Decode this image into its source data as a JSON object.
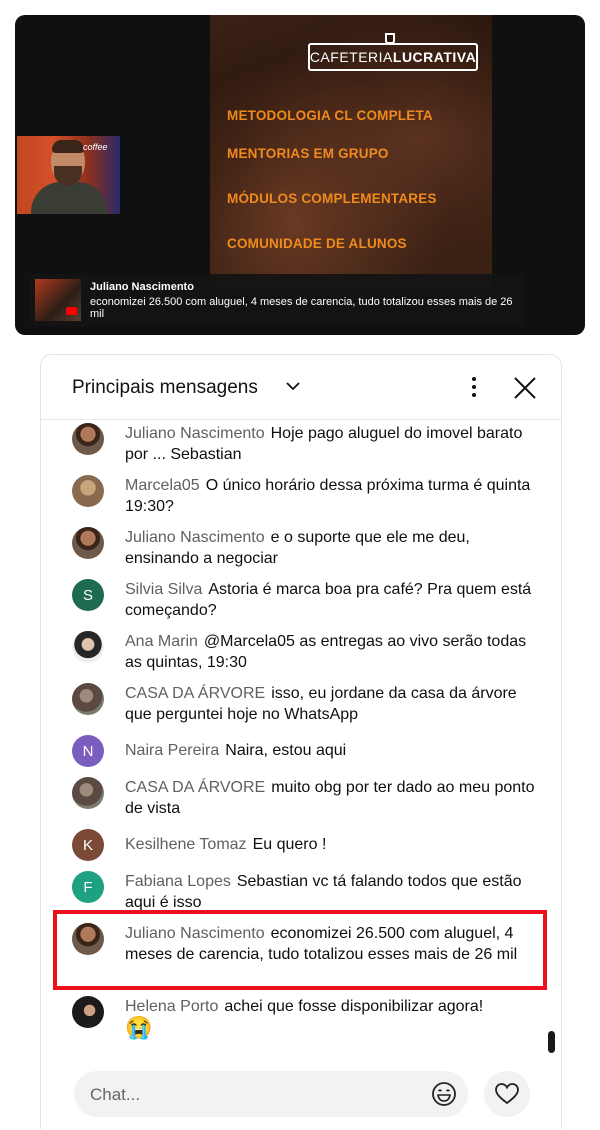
{
  "video": {
    "brand_left": "CAFETERIA",
    "brand_right": "LUCRATIVA",
    "menu": [
      "METODOLOGIA CL COMPLETA",
      "MENTORIAS EM GRUPO",
      "MÓDULOS COMPLEMENTARES",
      "COMUNIDADE DE ALUNOS"
    ],
    "webcam_sign": "coffee",
    "caption": {
      "author": "Juliano Nascimento",
      "message": "economizei 26.500 com aluguel, 4 meses de carencia, tudo totalizou esses mais de 26 mil"
    },
    "accent_color": "#f08a1c"
  },
  "chat": {
    "title": "Principais mensagens",
    "messages": [
      {
        "author": "Juliano Nascimento",
        "text": "Hoje pago aluguel do imovel barato por ... Sebastian",
        "avatar": "photo"
      },
      {
        "author": "Marcela05",
        "text": "O único horário dessa próxima turma é quinta 19:30?",
        "avatar": "photo"
      },
      {
        "author": "Juliano Nascimento",
        "text": "e o suporte que ele me deu, ensinando a negociar",
        "avatar": "photo"
      },
      {
        "author": "Silvia Silva",
        "text": "Astoria é marca boa pra café? Pra quem está começando?",
        "avatar": "S"
      },
      {
        "author": "Ana Marin",
        "text": "@Marcela05 as entregas ao vivo serão todas as quintas, 19:30",
        "avatar": "photo"
      },
      {
        "author": "CASA DA ÁRVORE",
        "text": "isso, eu jordane da casa da árvore que perguntei hoje no WhatsApp",
        "avatar": "photo"
      },
      {
        "author": "Naira Pereira",
        "text": "Naira, estou aqui",
        "avatar": "N"
      },
      {
        "author": "CASA DA ÁRVORE",
        "text": "muito obg por ter dado ao meu ponto de vista",
        "avatar": "photo"
      },
      {
        "author": "Kesilhene Tomaz",
        "text": "Eu quero !",
        "avatar": "K"
      },
      {
        "author": "Fabiana Lopes",
        "text": "Sebastian vc tá falando todos que estão aqui é isso",
        "avatar": "F"
      },
      {
        "author": "Juliano Nascimento",
        "text": "economizei 26.500 com aluguel, 4 meses de carencia, tudo totalizou esses mais de 26 mil",
        "avatar": "photo",
        "highlighted": true
      },
      {
        "author": "Helena Porto",
        "text": "achei que fosse disponibilizar agora!",
        "emoji": "😭",
        "avatar": "photo"
      }
    ],
    "input_placeholder": "Chat...",
    "highlight_color": "#ec0f1c"
  }
}
